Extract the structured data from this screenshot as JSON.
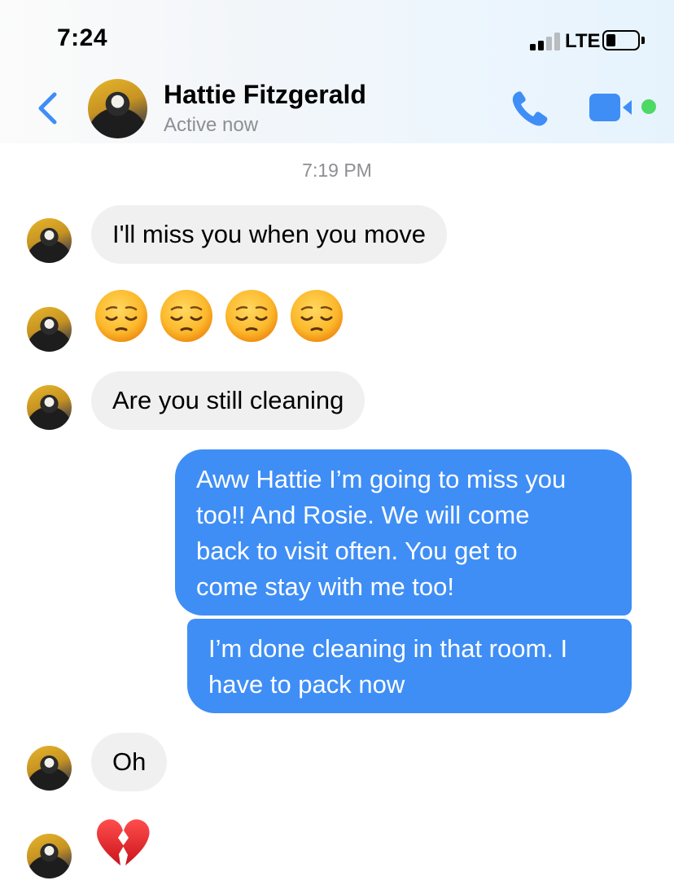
{
  "status_bar": {
    "time": "7:24",
    "network": "LTE"
  },
  "header": {
    "contact_name": "Hattie Fitzgerald",
    "contact_status": "Active now",
    "accent_color": "#3f8ef6",
    "active_color": "#4cd964"
  },
  "conversation": {
    "timestamp": "7:19 PM",
    "messages": [
      {
        "sender": "contact",
        "text": "I'll miss you when you move"
      },
      {
        "sender": "contact",
        "emoji": [
          "pensive-face",
          "pensive-face",
          "pensive-face",
          "pensive-face"
        ]
      },
      {
        "sender": "contact",
        "text": "Are you still cleaning"
      },
      {
        "sender": "me",
        "lines": [
          "Aww Hattie I’m going to miss you",
          "too!! And Rosie. We will come",
          "back to visit often. You get to",
          "come stay with me too!"
        ]
      },
      {
        "sender": "me",
        "lines": [
          "I’m done cleaning in that room. I",
          "have to pack now"
        ]
      },
      {
        "sender": "contact",
        "text": "Oh"
      },
      {
        "sender": "contact",
        "emoji": [
          "broken-heart"
        ]
      }
    ]
  }
}
